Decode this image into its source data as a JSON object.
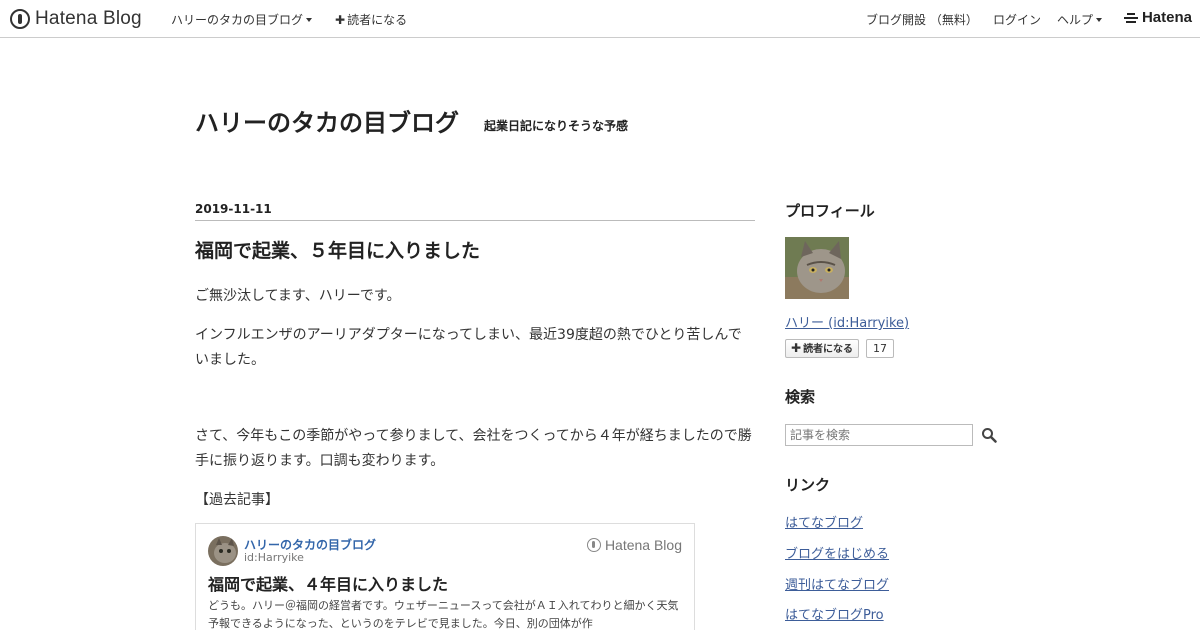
{
  "topbar": {
    "logo_text": "Hatena Blog",
    "blog_menu": "ハリーのタカの目ブログ",
    "subscribe": "読者になる",
    "open_blog": "ブログ開設 （無料）",
    "login": "ログイン",
    "help": "ヘルプ",
    "hatena_logo": "Hatena"
  },
  "header": {
    "title": "ハリーのタカの目ブログ",
    "description": "起業日記になりそうな予感"
  },
  "article": {
    "date": "2019-11-11",
    "title": "福岡で起業、５年目に入りました",
    "paragraphs": [
      "ご無沙汰してます、ハリーです。",
      "インフルエンザのアーリアダプターになってしまい、最近39度超の熱でひとり苦しんでいました。",
      "さて、今年もこの季節がやって参りまして、会社をつくってから４年が経ちましたので勝手に振り返ります。口調も変わります。",
      "【過去記事】"
    ],
    "embed": {
      "blog_name": "ハリーのタカの目ブログ",
      "user_id": "id:Harryike",
      "brand": "Hatena Blog",
      "title": "福岡で起業、４年目に入りました",
      "excerpt": "どうも。ハリー＠福岡の経営者です。ウェザーニュースって会社がＡＩ入れてわりと細かく天気予報できるようになった、というのをテレビで見ました。今日、別の団体が作"
    }
  },
  "sidebar": {
    "profile": {
      "heading": "プロフィール",
      "name_link": "ハリー (id:Harryike)",
      "subscribe_label": "読者になる",
      "subscriber_count": "17"
    },
    "search": {
      "heading": "検索",
      "placeholder": "記事を検索"
    },
    "links": {
      "heading": "リンク",
      "items": [
        "はてなブログ",
        "ブログをはじめる",
        "週刊はてなブログ",
        "はてなブログPro"
      ]
    }
  }
}
